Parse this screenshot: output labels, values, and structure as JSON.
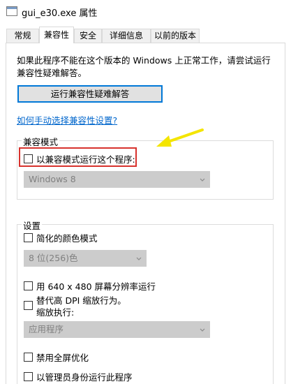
{
  "window": {
    "title": "gui_e30.exe 属性"
  },
  "tabs": [
    {
      "label": "常规",
      "active": false
    },
    {
      "label": "兼容性",
      "active": true
    },
    {
      "label": "安全",
      "active": false
    },
    {
      "label": "详细信息",
      "active": false
    },
    {
      "label": "以前的版本",
      "active": false
    }
  ],
  "compat": {
    "description": "如果此程序不能在这个版本的 Windows 上正常工作，请尝试运行兼容性疑难解答。",
    "troubleshoot_button": "运行兼容性疑难解答",
    "manual_link": "如何手动选择兼容性设置?"
  },
  "mode_group": {
    "label": "兼容模式",
    "checkbox_label": "以兼容模式运行这个程序:",
    "checked": false,
    "os_select_value": "Windows 8"
  },
  "settings_group": {
    "label": "设置",
    "reduced_color": {
      "label": "简化的颜色模式",
      "checked": false
    },
    "color_select_value": "8 位(256)色",
    "res_640": {
      "label": "用 640 x 480 屏幕分辨率运行",
      "checked": false
    },
    "dpi": {
      "line1": "替代高 DPI 缩放行为。",
      "line2": "缩放执行:",
      "checked": false
    },
    "dpi_select_value": "应用程序",
    "fullscreen": {
      "label": "禁用全屏优化",
      "checked": false
    },
    "admin": {
      "label": "以管理员身份运行此程序",
      "checked": false
    }
  },
  "colors": {
    "highlight_box": "#d7322d",
    "arrow": "#f4e500",
    "link": "#0066cc",
    "button_border": "#0078d7"
  }
}
